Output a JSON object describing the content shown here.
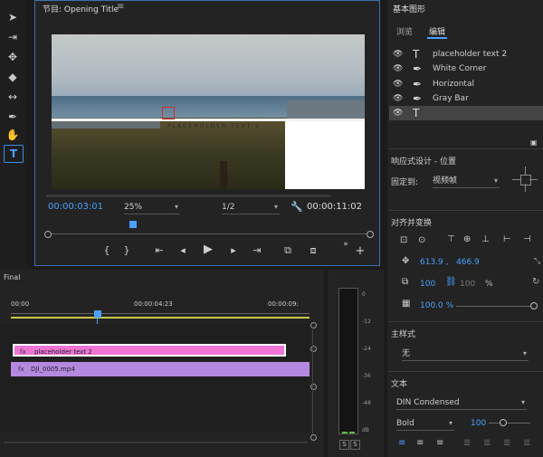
{
  "program_monitor": {
    "title": "节目: Opening Title",
    "menu_icon": "hamburger-icon",
    "overlay_text": "PLACEHOLDER TEXT 2",
    "timecode_current": "00:00:03:01",
    "timecode_duration": "00:00:11:02",
    "zoom": "25%",
    "resolution": "1/2"
  },
  "timeline": {
    "sequence_name": "Final",
    "ruler": [
      "00:00",
      "00:00:04:23",
      "00:00:09:"
    ],
    "clips": [
      {
        "label": "placeholder text 2",
        "color": "#ee74d6"
      },
      {
        "label": "DJI_0005.mp4",
        "color": "#b488e0"
      }
    ]
  },
  "audio_meter": {
    "ticks": [
      "0",
      "-12",
      "-24",
      "-36",
      "-48",
      "dB"
    ],
    "solo_left": "S",
    "solo_right": "S"
  },
  "essential_graphics": {
    "title": "基本图形",
    "tabs": [
      {
        "label": "浏览"
      },
      {
        "label": "编辑"
      }
    ],
    "layers": [
      {
        "name": "placeholder text 2",
        "icon": "text-icon"
      },
      {
        "name": "White Corner",
        "icon": "pen-icon"
      },
      {
        "name": "Horizontal",
        "icon": "pen-icon"
      },
      {
        "name": "Gray Bar",
        "icon": "pen-icon"
      },
      {
        "name": "",
        "icon": "text-icon"
      }
    ],
    "responsive_label": "响应式设计 - 位置",
    "pin_label": "固定到:",
    "pin_value": "视频帧",
    "align_label": "对齐并变换",
    "position_x": "613.9 ,",
    "position_y": "466.9",
    "scale": "100",
    "scale_locked": "100",
    "scale_unit": "%",
    "opacity": "100.0 %",
    "master_style_label": "主样式",
    "master_style_value": "无",
    "text_label": "文本",
    "font": "DIN Condensed",
    "font_style": "Bold",
    "font_size": "100"
  }
}
